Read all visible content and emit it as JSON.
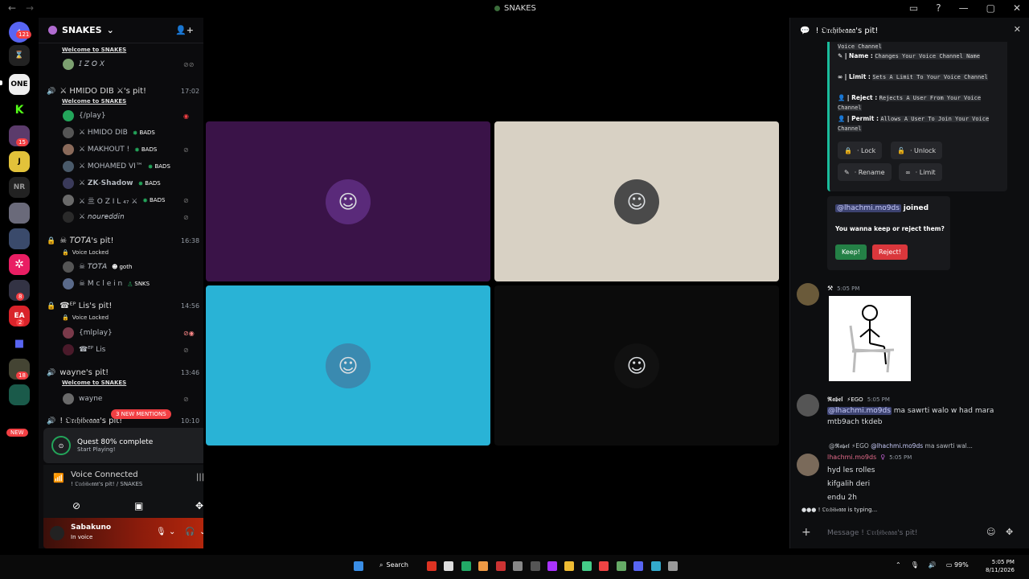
{
  "window": {
    "title": "SNAKES",
    "back": "←",
    "forward": "→",
    "controls": [
      "▭",
      "?",
      "—",
      "▢",
      "✕"
    ]
  },
  "guilds": {
    "badges": [
      "121",
      "15",
      "8",
      "2",
      "18"
    ],
    "new_label": "NEW",
    "icons": [
      "ONE",
      "K",
      "J",
      "NR",
      "EA"
    ]
  },
  "channels": {
    "server_name": "SNAKES",
    "voice": [
      {
        "name": "⚔ HMIDO DIB ⚔'s pit!",
        "time": "17:02",
        "welcome": "Welcome to SNAKES"
      },
      {
        "name": "☠ 𝘛𝘖𝘛𝘈's pit!",
        "time": "16:38",
        "status": "Voice Locked"
      },
      {
        "name": "☎ᴱᴾ Lis's pit!",
        "time": "14:56",
        "status": "Voice Locked"
      },
      {
        "name": "wayne's pit!",
        "time": "13:46",
        "welcome": "Welcome to SNAKES"
      },
      {
        "name": "! 𝔒𝔯𝔠𝔥𝔦𝔟𝔢𝔞𝔞𝔞's pit!",
        "time": "10:10"
      }
    ],
    "top_welcome": "Welcome to SNAKES",
    "users": [
      {
        "name": "𝘐 𝘡 𝘖 𝘟",
        "tag": ""
      },
      {
        "name": "{/play}",
        "tag": ""
      },
      {
        "name": "⚔ HMIDO DIB",
        "tag": "BADS"
      },
      {
        "name": "⚔ MAKHOUT !",
        "tag": "BADS"
      },
      {
        "name": "⚔ MOHAMED VI™",
        "tag": "BADS"
      },
      {
        "name": "⚔ 𝗭𝗞-𝗦𝗵𝗮𝗱𝗼𝘄",
        "tag": "BADS"
      },
      {
        "name": "⚔ 亖 O Z I L ₄₇ ⚔",
        "tag": "BADS"
      },
      {
        "name": "⚔ 𝘯𝘰𝘶𝘳𝘦𝘥𝘥𝘪𝘯",
        "tag": ""
      },
      {
        "name": "☠ 𝘛𝘖𝘛𝘈",
        "tag": "goth"
      },
      {
        "name": "☠ M c l e i n",
        "tag": "SNKS"
      },
      {
        "name": "{mlplay}",
        "tag": ""
      },
      {
        "name": "☎ᴱᴾ Lis",
        "tag": ""
      },
      {
        "name": "wayne",
        "tag": ""
      }
    ],
    "mentions": "3 NEW MENTIONS"
  },
  "quest": {
    "title": "Quest 80% complete",
    "sub": "Start Playing!",
    "progress": 0.8
  },
  "voice_panel": {
    "status": "Voice Connected",
    "location": "! 𝔒𝔯𝔠𝔥𝔦𝔟𝔢𝔞𝔞𝔞's pit! / SNAKES"
  },
  "userbar": {
    "name": "𝗦𝗮𝗯𝗮𝗸𝘂𝗻𝗼",
    "status": "In voice"
  },
  "tiles": [
    {
      "bg": "#3a1348"
    },
    {
      "bg": "#d8d1c4"
    },
    {
      "bg": "#29b3d6"
    },
    {
      "bg": "#0b0b0b"
    }
  ],
  "side": {
    "title": "! 𝔒𝔯𝔠𝔥𝔦𝔟𝔢𝔞𝔞𝔞's pit!",
    "embed": {
      "vc_line": "Voice Channel",
      "name_label": "| Name :",
      "name_desc": "Changes Your Voice Channel Name",
      "limit_label": "| Limit :",
      "limit_desc": "Sets A Limit To Your Voice Channel",
      "reject_label": "| Reject :",
      "reject_desc": "Rejects A User From Your Voice Channel",
      "permit_label": "| Permit :",
      "permit_desc": "Allows A User To Join Your Voice Channel",
      "buttons": [
        "· Lock",
        "· Unlock",
        "· Rename",
        "· Limit"
      ]
    },
    "join": {
      "mention": "@lhachmi.mo9ds",
      "joined": "joined",
      "question": "You wanna keep or reject them?",
      "keep": "Keep!",
      "reject": "Reject!"
    },
    "messages": [
      {
        "author": "",
        "time": "5:05 PM"
      },
      {
        "author": "𝕽𝖆𝖇𝖊𝖑",
        "tag": "EGO",
        "time": "5:05 PM",
        "mention": "@lhachmi.mo9ds",
        "text": "ma sawrti walo w had mara mtb9ach tkdeb"
      },
      {
        "reply_author": "@𝕽𝖆𝖇𝖊𝖑",
        "reply_tag": "EGO",
        "reply_mention": "@lhachmi.mo9ds",
        "reply_text": "ma sawrti wal...",
        "author": "lhachmi.mo9ds",
        "time": "5:05 PM",
        "lines": [
          "hyd les rolles",
          "kifgalih deri",
          "endu 2h"
        ]
      }
    ],
    "typing": "! 𝔒𝔯𝔠𝔥𝔦𝔟𝔢𝔞𝔞𝔞 is typing...",
    "placeholder": "Message ! 𝔒𝔯𝔠𝔥𝔦𝔟𝔢𝔞𝔞𝔞's pit!"
  },
  "taskbar": {
    "search": "Search",
    "battery": "99%",
    "time": "5:05 PM",
    "date": "8/11/2026"
  }
}
